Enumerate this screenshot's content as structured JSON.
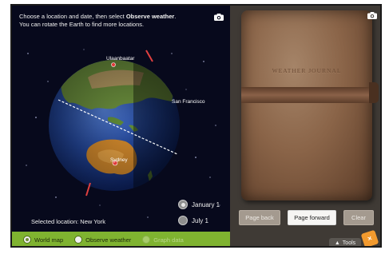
{
  "instructions": {
    "line1_prefix": "Choose a location and date, then select ",
    "line1_bold": "Observe weather",
    "line1_suffix": ".",
    "line2": "You can rotate the Earth to find more locations."
  },
  "cities": {
    "ulaanbaatar": "Ulaanbaatar",
    "san_francisco": "San Francisco",
    "sydney": "Sydney"
  },
  "dates": [
    {
      "label": "January 1"
    },
    {
      "label": "July 1"
    }
  ],
  "selected_location": "Selected location: New York",
  "tabs": [
    {
      "label": "World map"
    },
    {
      "label": "Observe weather"
    },
    {
      "label": "Graph data"
    }
  ],
  "journal_title": "WEATHER JOURNAL",
  "buttons": {
    "page_back": "Page back",
    "page_forward": "Page forward",
    "clear": "Clear"
  },
  "tools_label": "Tools",
  "icons": [
    "camera-icon",
    "camera-icon",
    "tools-up-arrow-icon",
    "x-logo-icon"
  ],
  "colors": {
    "space": "#07091c",
    "tab_bar": "#7fb330",
    "journal_leather": "#8a6448",
    "button_active": "#f6f5f3",
    "button_disabled": "#a49a8f"
  }
}
